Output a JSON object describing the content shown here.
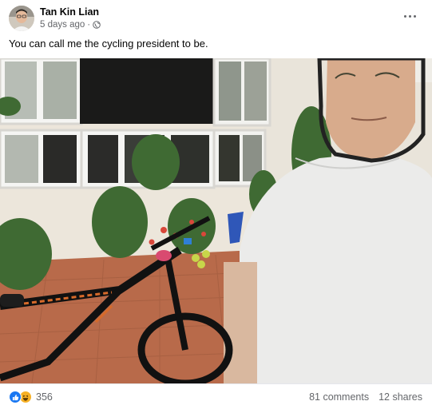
{
  "post": {
    "author": "Tan Kin Lian",
    "time": "5 days ago",
    "separator": "·",
    "privacy_icon": "globe-icon",
    "more_icon": "more-options-icon",
    "caption": "You can call me the cycling president to be."
  },
  "photo": {
    "subject": "man-with-bicycle-photo"
  },
  "footer": {
    "reaction_icons": [
      "like-reaction-icon",
      "haha-reaction-icon"
    ],
    "reaction_count": "356",
    "comments": "81 comments",
    "shares": "12 shares"
  },
  "colors": {
    "like": "#1877f2",
    "haha": "#f7b125",
    "meta_text": "#65676b"
  }
}
